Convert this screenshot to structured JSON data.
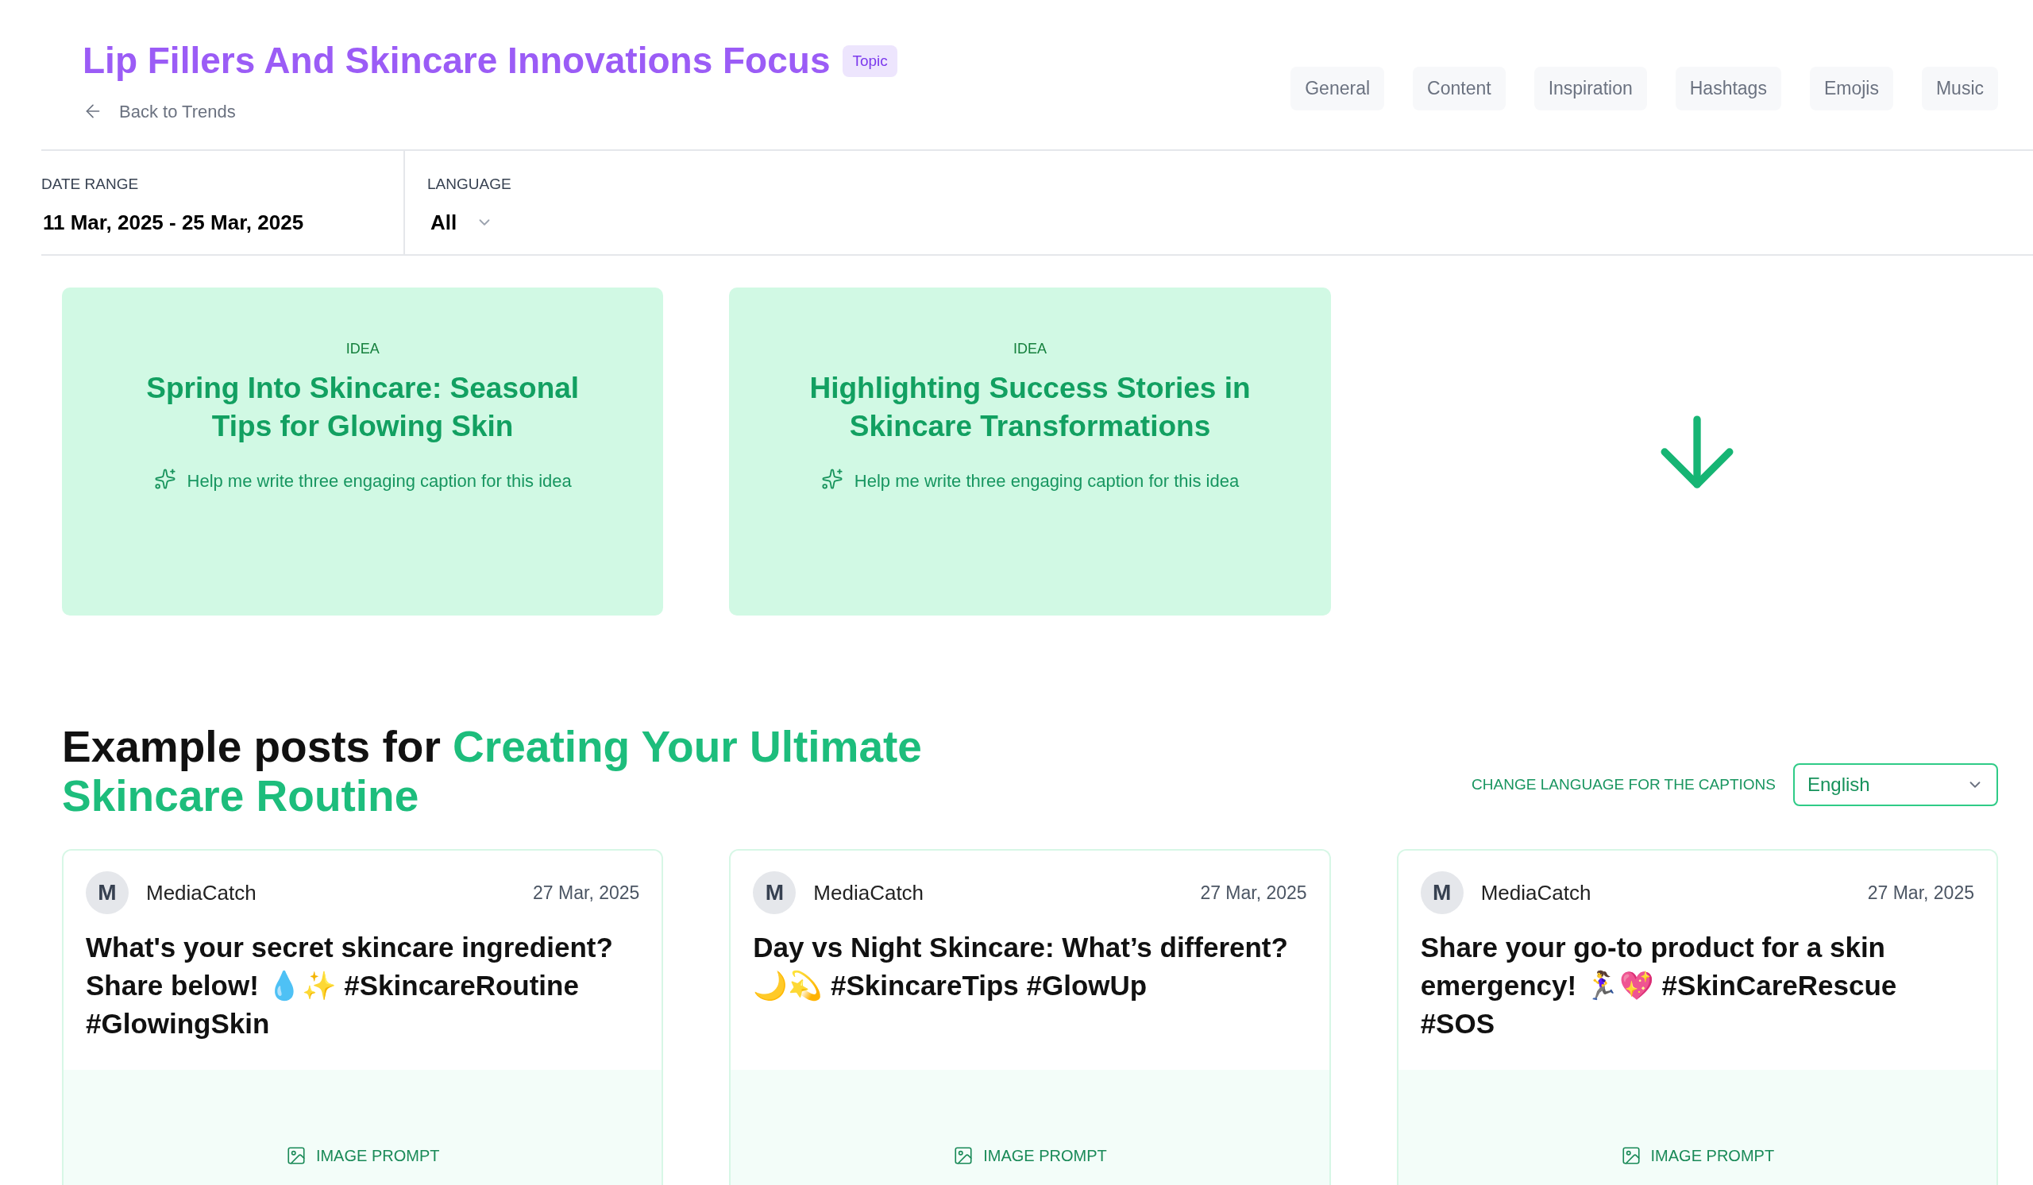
{
  "header": {
    "title": "Lip Fillers And Skincare Innovations Focus",
    "badge": "Topic",
    "back_link": "Back to Trends"
  },
  "tabs": [
    {
      "label": "General"
    },
    {
      "label": "Content"
    },
    {
      "label": "Inspiration"
    },
    {
      "label": "Hashtags"
    },
    {
      "label": "Emojis"
    },
    {
      "label": "Music"
    }
  ],
  "filters": [
    {
      "kind": "text",
      "label": "DATE RANGE",
      "value": "11 Mar, 2025 - 25 Mar, 2025"
    },
    {
      "kind": "dropdown",
      "label": "LANGUAGE",
      "value": "All"
    }
  ],
  "ideas": [
    {
      "tag": "IDEA",
      "title": "Spring Into Skincare: Seasonal Tips for Glowing Skin",
      "prompt": "Help me write three engaging caption for this idea"
    },
    {
      "tag": "IDEA",
      "title": "Highlighting Success Stories in Skincare Transformations",
      "prompt": "Help me write three engaging caption for this idea"
    }
  ],
  "examples": {
    "heading_prefix": "Example posts for",
    "heading_highlight": "Creating Your Ultimate Skincare Routine",
    "language_label": "CHANGE LANGUAGE FOR THE CAPTIONS",
    "language_value": "English"
  },
  "posts": [
    {
      "avatar": "M",
      "author": "MediaCatch",
      "date": "27 Mar, 2025",
      "caption": "What's your secret skincare ingredient? Share below! 💧✨ #SkincareRoutine #GlowingSkin",
      "media_label": "IMAGE PROMPT"
    },
    {
      "avatar": "M",
      "author": "MediaCatch",
      "date": "27 Mar, 2025",
      "caption": "Day vs Night Skincare: What’s different? 🌙💫 #SkincareTips #GlowUp",
      "media_label": "IMAGE PROMPT"
    },
    {
      "avatar": "M",
      "author": "MediaCatch",
      "date": "27 Mar, 2025",
      "caption": "Share your go-to product for a skin emergency! 🏃‍♀️💖 #SkinCareRescue #SOS",
      "media_label": "IMAGE PROMPT"
    }
  ]
}
